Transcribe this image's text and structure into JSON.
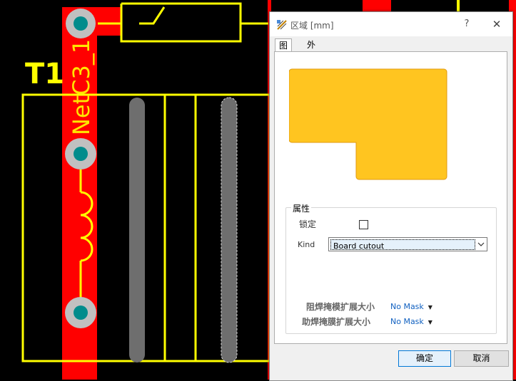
{
  "pcb": {
    "designator": "T1",
    "net_label": "NetC3_1",
    "colors": {
      "background": "#000000",
      "top_copper": "#ff0000",
      "silkscreen": "#ffff00",
      "pad_ring": "#c0c0c0",
      "pad_hole": "#008c8c",
      "keepout_gray": "#6e6e6e",
      "bottom_layer": "#3b3bff"
    }
  },
  "dialog": {
    "title": "区域 [mm]",
    "help_label": "?",
    "close_label": "✕",
    "tabs": [
      {
        "label": "图形",
        "active": true
      },
      {
        "label": "外框顶点",
        "active": false
      }
    ],
    "preview_fill": "#ffc520",
    "preview_stroke": "#e09a10",
    "properties": {
      "group_title": "属性",
      "lock_label": "锁定",
      "lock_checked": false,
      "kind_label": "Kind",
      "kind_value": "Board cutout",
      "solder_mask_label": "阻焊掩模扩展大小",
      "solder_mask_value": "No Mask",
      "paste_mask_label": "助焊掩膜扩展大小",
      "paste_mask_value": "No Mask"
    },
    "ok_label": "确定",
    "cancel_label": "取消"
  }
}
